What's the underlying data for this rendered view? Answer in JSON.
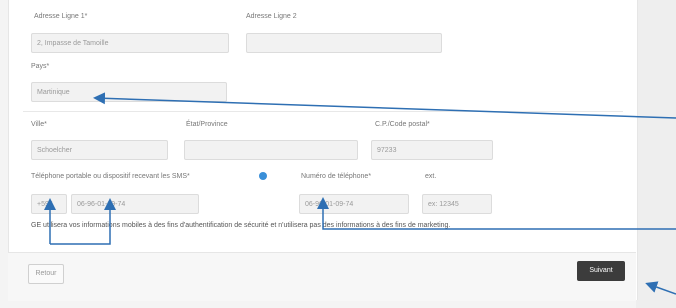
{
  "form": {
    "address1": {
      "label": "Adresse Ligne 1*",
      "value": "2, Impasse de Tamoille"
    },
    "address2": {
      "label": "Adresse Ligne 2",
      "value": ""
    },
    "country": {
      "label": "Pays*",
      "value": "Martinique"
    },
    "city": {
      "label": "Ville*",
      "value": "Schoelcher"
    },
    "state": {
      "label": "État/Province",
      "value": ""
    },
    "postal": {
      "label": "C.P./Code postal*",
      "value": "97233"
    },
    "mobile": {
      "label": "Téléphone portable ou dispositif recevant les SMS*",
      "prefix": "+596",
      "value": "06-96-01-09-74"
    },
    "phone": {
      "label": "Numéro de téléphone*",
      "value": "06-96-01-09-74"
    },
    "ext": {
      "label": "ext.",
      "placeholder": "ex: 12345"
    },
    "note": "GE utilisera vos informations mobiles à des fins d'authentification de sécurité et n'utilisera pas des informations à des fins de marketing."
  },
  "footer": {
    "back_label": "Retour",
    "next_label": "Suivant"
  },
  "icons": {
    "info": "info-icon"
  },
  "colors": {
    "accent": "#3a8fd8",
    "arrow": "#2e6fb3",
    "primary_button": "#3c3c3c"
  }
}
